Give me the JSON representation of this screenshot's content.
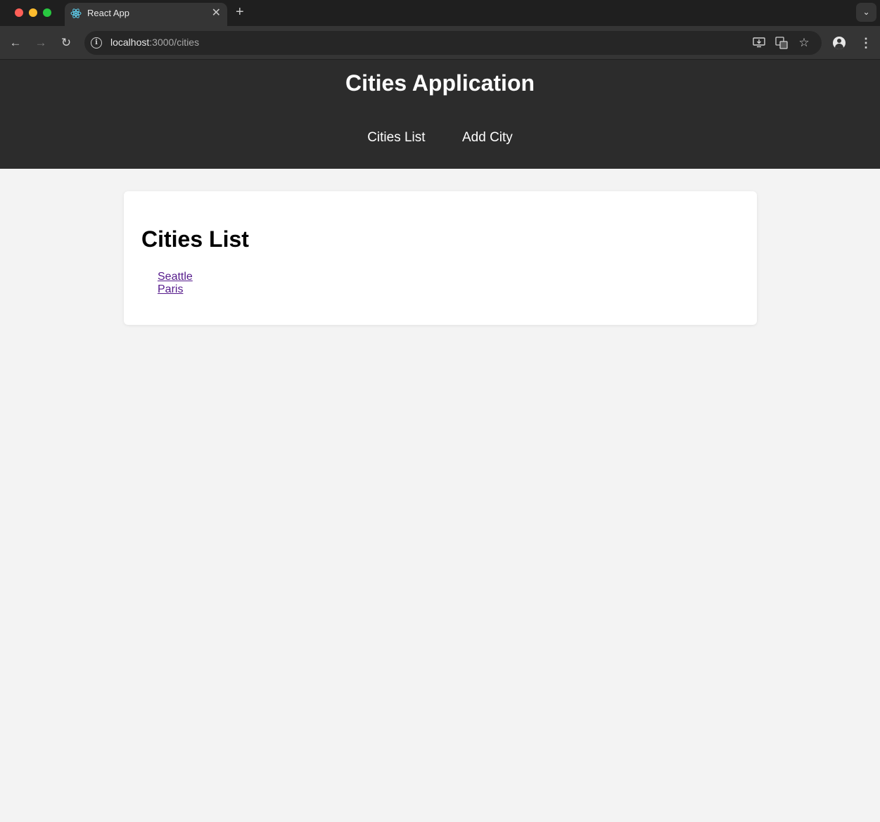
{
  "browser": {
    "tab_title": "React App",
    "tab_close": "✕",
    "new_tab": "+",
    "url_host": "localhost",
    "url_path": ":3000/cities",
    "icons": [
      "back-icon",
      "forward-icon",
      "reload-icon",
      "info-icon",
      "install-icon",
      "translate-icon",
      "star-icon",
      "profile-icon",
      "menu-icon"
    ]
  },
  "app": {
    "title": "Cities Application",
    "nav": [
      {
        "label": "Cities List"
      },
      {
        "label": "Add City"
      }
    ]
  },
  "main": {
    "heading": "Cities List",
    "cities": [
      {
        "name": "Seattle"
      },
      {
        "name": "Paris"
      }
    ]
  },
  "colors": {
    "header_bg": "#2c2c2c",
    "page_bg": "#f3f3f3",
    "link_visited": "#551a8b"
  }
}
